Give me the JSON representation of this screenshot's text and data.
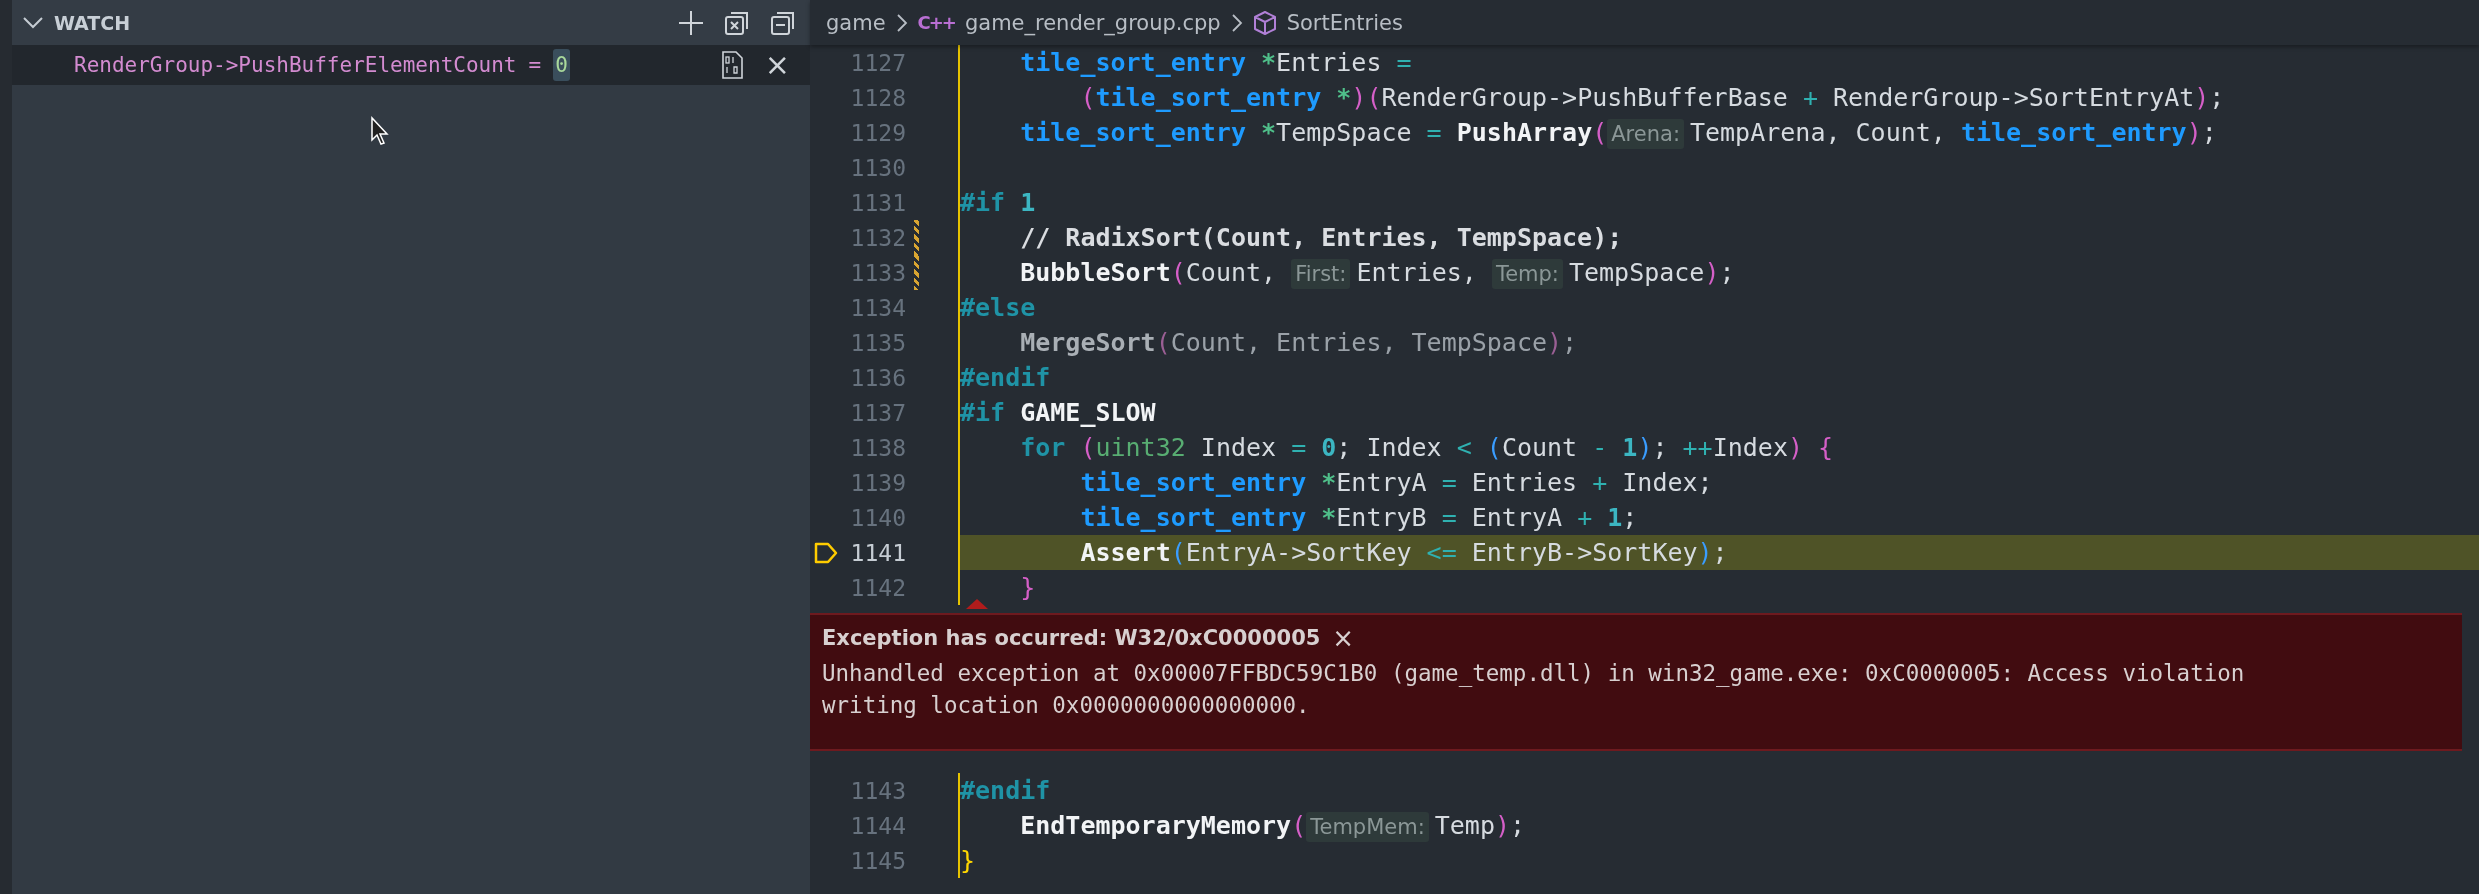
{
  "sidebar": {
    "watch": {
      "title": "WATCH",
      "expanded": true,
      "items": [
        {
          "expression": "RenderGroup->PushBufferElementCount",
          "operator": "=",
          "value": "0",
          "close": "×"
        }
      ]
    }
  },
  "breadcrumb": {
    "items": [
      {
        "label": "game",
        "kind": "folder"
      },
      {
        "label": "game_render_group.cpp",
        "kind": "file",
        "icon_text": "C++"
      },
      {
        "label": "SortEntries",
        "kind": "symbol"
      }
    ]
  },
  "code": {
    "lines_before": [
      {
        "number": "1127",
        "modified": false,
        "current": false,
        "tokens": [
          {
            "kind": "type",
            "text": "    tile_sort_entry"
          },
          {
            "kind": "star",
            "text": " *"
          },
          {
            "kind": "plain",
            "text": "Entries "
          },
          {
            "kind": "op",
            "text": "="
          }
        ]
      },
      {
        "number": "1128",
        "modified": false,
        "current": false,
        "tokens": [
          {
            "kind": "paren",
            "text": "        ("
          },
          {
            "kind": "type",
            "text": "tile_sort_entry"
          },
          {
            "kind": "star",
            "text": " *"
          },
          {
            "kind": "paren",
            "text": ")("
          },
          {
            "kind": "plain",
            "text": "RenderGroup->PushBufferBase "
          },
          {
            "kind": "op",
            "text": "+"
          },
          {
            "kind": "plain",
            "text": " RenderGroup->SortEntryAt"
          },
          {
            "kind": "paren",
            "text": ")"
          },
          {
            "kind": "plain",
            "text": ";"
          }
        ]
      },
      {
        "number": "1129",
        "modified": false,
        "current": false,
        "tokens": [
          {
            "kind": "type",
            "text": "    tile_sort_entry"
          },
          {
            "kind": "star",
            "text": " *"
          },
          {
            "kind": "plain",
            "text": "TempSpace "
          },
          {
            "kind": "op",
            "text": "="
          },
          {
            "kind": "func",
            "text": " PushArray"
          },
          {
            "kind": "paren",
            "text": "("
          },
          {
            "kind": "hint",
            "text": "Arena:"
          },
          {
            "kind": "plain",
            "text": "TempArena, Count, "
          },
          {
            "kind": "type",
            "text": "tile_sort_entry"
          },
          {
            "kind": "paren",
            "text": ")"
          },
          {
            "kind": "plain",
            "text": ";"
          }
        ]
      },
      {
        "number": "1130",
        "modified": false,
        "current": false
      },
      {
        "number": "1131",
        "modified": false,
        "current": false,
        "tokens": [
          {
            "kind": "directive",
            "text": "#if"
          },
          {
            "kind": "number",
            "text": " 1"
          }
        ]
      },
      {
        "number": "1132",
        "modified": true,
        "current": false,
        "tokens": [
          {
            "kind": "comment",
            "text": "    // RadixSort(Count, Entries, TempSpace);"
          }
        ]
      },
      {
        "number": "1133",
        "modified": true,
        "current": false,
        "tokens": [
          {
            "kind": "func",
            "text": "    BubbleSort"
          },
          {
            "kind": "paren",
            "text": "("
          },
          {
            "kind": "plain",
            "text": "Count, "
          },
          {
            "kind": "hint",
            "text": "First:"
          },
          {
            "kind": "plain",
            "text": "Entries, "
          },
          {
            "kind": "hint",
            "text": "Temp:"
          },
          {
            "kind": "plain",
            "text": "TempSpace"
          },
          {
            "kind": "paren",
            "text": ")"
          },
          {
            "kind": "plain",
            "text": ";"
          }
        ]
      },
      {
        "number": "1134",
        "modified": false,
        "current": false,
        "tokens": [
          {
            "kind": "directive",
            "text": "#else"
          }
        ]
      },
      {
        "number": "1135",
        "modified": false,
        "current": false,
        "tokens": [
          {
            "kind": "dimfunc",
            "text": "    MergeSort"
          },
          {
            "kind": "dimparen",
            "text": "("
          },
          {
            "kind": "dim",
            "text": "Count, Entries, TempSpace"
          },
          {
            "kind": "dimparen",
            "text": ")"
          },
          {
            "kind": "dim",
            "text": ";"
          }
        ]
      },
      {
        "number": "1136",
        "modified": false,
        "current": false,
        "tokens": [
          {
            "kind": "directive",
            "text": "#endif"
          }
        ]
      },
      {
        "number": "1137",
        "modified": false,
        "current": false,
        "tokens": [
          {
            "kind": "directive",
            "text": "#if"
          },
          {
            "kind": "func",
            "text": " GAME_SLOW"
          }
        ]
      },
      {
        "number": "1138",
        "modified": false,
        "current": false,
        "tokens": [
          {
            "kind": "directive",
            "text": "    for"
          },
          {
            "kind": "paren",
            "text": " ("
          },
          {
            "kind": "primitive",
            "text": "uint32"
          },
          {
            "kind": "plain",
            "text": " Index "
          },
          {
            "kind": "op",
            "text": "="
          },
          {
            "kind": "number",
            "text": " 0"
          },
          {
            "kind": "plain",
            "text": "; Index "
          },
          {
            "kind": "op",
            "text": "<"
          },
          {
            "kind": "paren2",
            "text": " ("
          },
          {
            "kind": "plain",
            "text": "Count "
          },
          {
            "kind": "op",
            "text": "-"
          },
          {
            "kind": "number",
            "text": " 1"
          },
          {
            "kind": "paren2",
            "text": ")"
          },
          {
            "kind": "plain",
            "text": "; "
          },
          {
            "kind": "op",
            "text": "++"
          },
          {
            "kind": "plain",
            "text": "Index"
          },
          {
            "kind": "paren",
            "text": ")"
          },
          {
            "kind": "paren",
            "text": " {"
          }
        ]
      },
      {
        "number": "1139",
        "modified": false,
        "current": false,
        "tokens": [
          {
            "kind": "type",
            "text": "        tile_sort_entry"
          },
          {
            "kind": "star",
            "text": " *"
          },
          {
            "kind": "plain",
            "text": "EntryA "
          },
          {
            "kind": "op",
            "text": "="
          },
          {
            "kind": "plain",
            "text": " Entries "
          },
          {
            "kind": "op",
            "text": "+"
          },
          {
            "kind": "plain",
            "text": " Index;"
          }
        ]
      },
      {
        "number": "1140",
        "modified": false,
        "current": false,
        "tokens": [
          {
            "kind": "type",
            "text": "        tile_sort_entry"
          },
          {
            "kind": "star",
            "text": " *"
          },
          {
            "kind": "plain",
            "text": "EntryB "
          },
          {
            "kind": "op",
            "text": "="
          },
          {
            "kind": "plain",
            "text": " EntryA "
          },
          {
            "kind": "op",
            "text": "+"
          },
          {
            "kind": "number",
            "text": " 1"
          },
          {
            "kind": "plain",
            "text": ";"
          }
        ]
      },
      {
        "number": "1141",
        "modified": false,
        "current": true,
        "tokens": [
          {
            "kind": "func",
            "text": "        Assert"
          },
          {
            "kind": "paren2",
            "text": "("
          },
          {
            "kind": "plain",
            "text": "EntryA->SortKey "
          },
          {
            "kind": "op",
            "text": "<="
          },
          {
            "kind": "plain",
            "text": " EntryB->SortKey"
          },
          {
            "kind": "paren2",
            "text": ")"
          },
          {
            "kind": "plain",
            "text": ";"
          }
        ]
      },
      {
        "number": "1142",
        "modified": false,
        "current": false,
        "tokens": [
          {
            "kind": "paren",
            "text": "    }"
          }
        ]
      }
    ],
    "exception": {
      "title": "Exception has occurred: W32/0xC0000005",
      "close": "×",
      "message": "Unhandled exception at 0x00007FFBDC59C1B0 (game_temp.dll) in win32_game.exe: 0xC0000005: Access violation writing location 0x0000000000000000."
    },
    "lines_after": [
      {
        "number": "1143",
        "modified": false,
        "current": false,
        "tokens": [
          {
            "kind": "directive",
            "text": "#endif"
          }
        ]
      },
      {
        "number": "1144",
        "modified": false,
        "current": false,
        "tokens": [
          {
            "kind": "func",
            "text": "    EndTemporaryMemory"
          },
          {
            "kind": "paren",
            "text": "("
          },
          {
            "kind": "hint",
            "text": "TempMem:"
          },
          {
            "kind": "plain",
            "text": "Temp"
          },
          {
            "kind": "paren",
            "text": ")"
          },
          {
            "kind": "plain",
            "text": ";"
          }
        ]
      },
      {
        "number": "1145",
        "modified": false,
        "current": false,
        "tokens": [
          {
            "kind": "brace",
            "text": "}"
          }
        ]
      }
    ]
  }
}
